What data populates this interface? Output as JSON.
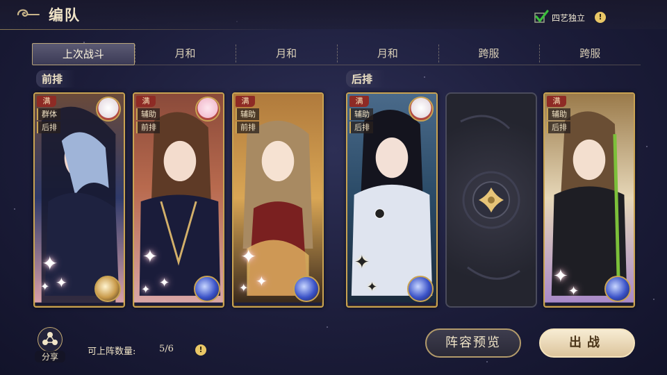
{
  "header": {
    "title": "编队"
  },
  "toggle": {
    "label": "四艺独立",
    "checked": true
  },
  "tabs": [
    {
      "label": "上次战斗",
      "active": true
    },
    {
      "label": "月和",
      "active": false
    },
    {
      "label": "月和",
      "active": false
    },
    {
      "label": "月和",
      "active": false
    },
    {
      "label": "跨服",
      "active": false
    },
    {
      "label": "跨服",
      "active": false
    }
  ],
  "sections": {
    "front": "前排",
    "back": "后排"
  },
  "cards": [
    {
      "badge": "满",
      "tags": [
        "群体",
        "后排"
      ],
      "has_pet": true
    },
    {
      "badge": "满",
      "tags": [
        "辅助",
        "前排"
      ],
      "has_pet": true
    },
    {
      "badge": "满",
      "tags": [
        "辅助",
        "前排"
      ],
      "has_pet": false
    },
    {
      "badge": "满",
      "tags": [
        "辅助",
        "后排"
      ],
      "has_pet": true
    },
    {
      "badge": "满",
      "tags": [
        "辅助",
        "后排"
      ],
      "has_pet": false
    }
  ],
  "footer": {
    "share_label": "分享",
    "count_label": "可上阵数量:",
    "count_value": "5/6",
    "preview_button": "阵容预览",
    "fight_button": "出战"
  },
  "colors": {
    "accent_gold": "#c9a352",
    "badge_red": "#8e2b25",
    "check_green": "#3bbf3b"
  }
}
